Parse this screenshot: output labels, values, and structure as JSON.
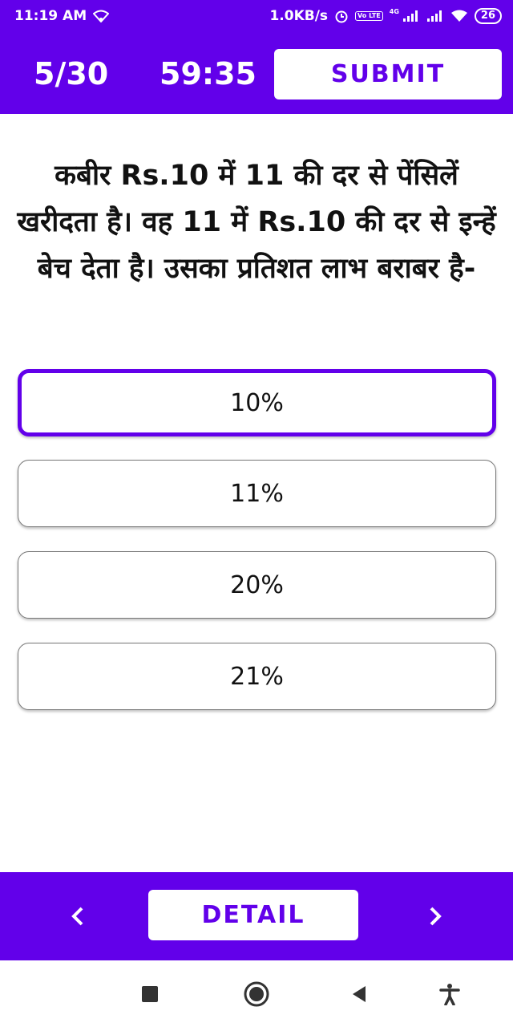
{
  "status_bar": {
    "time": "11:19 AM",
    "net_speed": "1.0KB/s",
    "network_type": "4G",
    "lte_label": "Vo LTE",
    "battery": "26",
    "icons": [
      "wifi-icon",
      "alarm-icon",
      "volte-icon",
      "signal-icon",
      "signal-icon",
      "wifi-icon",
      "battery-icon"
    ]
  },
  "header": {
    "counter": "5/30",
    "timer": "59:35",
    "submit_label": "SUBMIT"
  },
  "question": {
    "text": "कबीर  Rs.10 में 11 की दर से पेंसिलें खरीदता है। वह 11 में  Rs.10 की दर से इन्हें बेच देता है। उसका प्रतिशत लाभ बराबर है-"
  },
  "options": [
    {
      "label": "10%",
      "selected": true
    },
    {
      "label": "11%",
      "selected": false
    },
    {
      "label": "20%",
      "selected": false
    },
    {
      "label": "21%",
      "selected": false
    }
  ],
  "footer": {
    "prev_icon": "chevron-left-icon",
    "detail_label": "DETAIL",
    "next_icon": "chevron-right-icon"
  },
  "system_nav": {
    "icons": [
      "recents-icon",
      "home-icon",
      "back-icon",
      "accessibility-icon"
    ]
  },
  "colors": {
    "accent": "#6200ea",
    "background": "#ffffff"
  }
}
